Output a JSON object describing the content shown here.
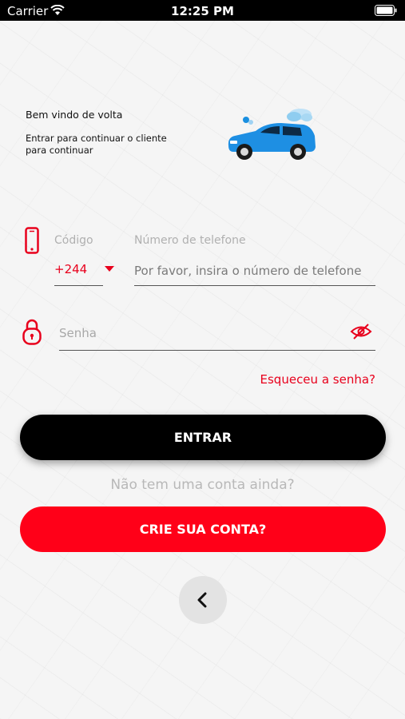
{
  "status_bar": {
    "carrier": "Carrier",
    "time": "12:25 PM"
  },
  "welcome": {
    "title": "Bem vindo de volta",
    "subtitle": "Entrar para continuar o cliente para continuar"
  },
  "login_form": {
    "code_label": "Código",
    "code_value": "+244",
    "phone_label": "Número de telefone",
    "phone_placeholder": "Por favor, insira o número de telefone",
    "password_placeholder": "Senha",
    "forgot_password": "Esqueceu a senha?"
  },
  "actions": {
    "login_label": "ENTRAR",
    "no_account_text": "Não tem uma conta ainda?",
    "create_account_label": "CRIE SUA CONTA?"
  },
  "icons": {
    "phone": "phone-icon",
    "lock": "lock-icon",
    "eye": "eye-off-icon",
    "back": "chevron-left-icon",
    "caret": "caret-down-icon"
  },
  "colors": {
    "accent": "#e8001c",
    "login_button": "#000000",
    "create_button": "#ff0018"
  }
}
